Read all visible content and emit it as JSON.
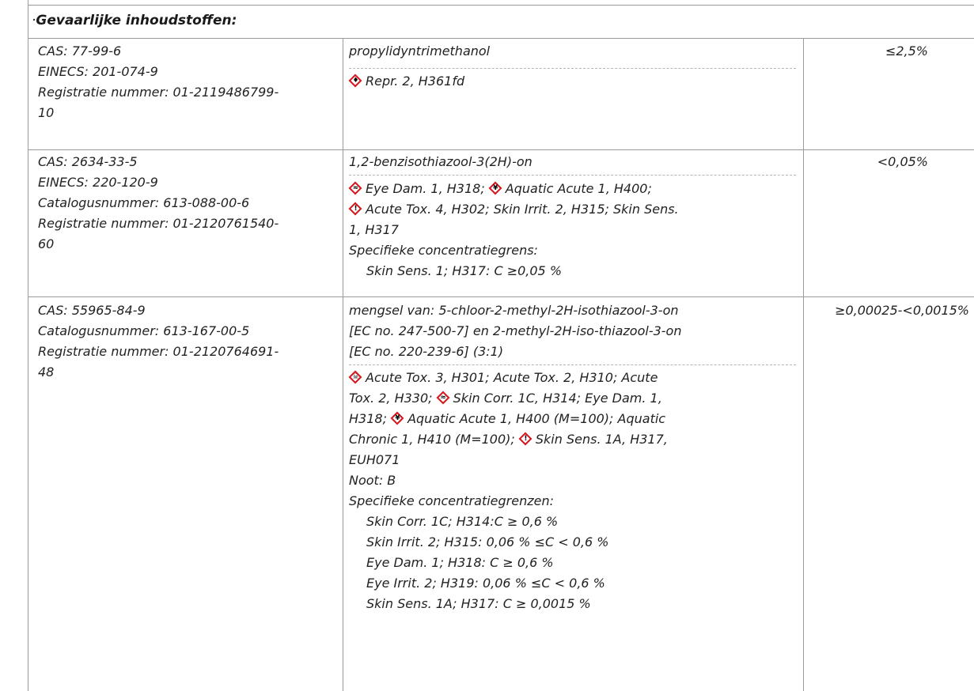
{
  "section": {
    "bullet": "·",
    "title": "Gevaarlijke inhoudstoffen:"
  },
  "rows": [
    {
      "left": [
        "CAS: 77-99-6",
        "EINECS: 201-074-9",
        "Registratie nummer: 01-2119486799-",
        "10"
      ],
      "name": "propylidyntrimethanol",
      "hazards": [
        "Repr. 2, H361fd"
      ],
      "concentration": "≤2,5%"
    },
    {
      "left": [
        "CAS: 2634-33-5",
        "EINECS: 220-120-9",
        "Catalogusnummer: 613-088-00-6",
        "Registratie nummer: 01-2120761540-",
        "60"
      ],
      "name": "1,2-benzisothiazool-3(2H)-on",
      "hazards": [
        "Eye Dam. 1, H318;",
        "Aquatic Acute 1, H400;",
        "Acute Tox. 4, H302; Skin Irrit. 2, H315; Skin Sens.",
        "1, H317",
        "Specifieke concentratiegrens:",
        "Skin Sens. 1; H317: C ≥0,05 %"
      ],
      "concentration": "<0,05%"
    },
    {
      "left": [
        "CAS: 55965-84-9",
        "Catalogusnummer: 613-167-00-5",
        "Registratie nummer: 01-2120764691-",
        "48"
      ],
      "name": [
        "mengsel van: 5-chloor-2-methyl-2H-isothiazool-3-on",
        "[EC no. 247-500-7] en 2-methyl-2H-iso-thiazool-3-on",
        "[EC no. 220-239-6] (3:1)"
      ],
      "hazards": [
        "Acute Tox. 3, H301; Acute Tox. 2, H310; Acute",
        "Tox. 2, H330;",
        "Skin Corr. 1C, H314; Eye Dam. 1,",
        "H318;",
        "Aquatic Acute 1, H400 (M=100); Aquatic",
        "Chronic 1, H410 (M=100);",
        "Skin Sens. 1A, H317,",
        "EUH071",
        "Noot: B",
        "Specifieke concentratiegrenzen:",
        "Skin Corr. 1C; H314:C ≥ 0,6 %",
        "Skin Irrit. 2; H315: 0,06 % ≤C < 0,6 %",
        "Eye Dam. 1; H318: C ≥ 0,6 %",
        "Eye Irrit. 2; H319: 0,06 % ≤C < 0,6 %",
        "Skin Sens. 1A; H317: C ≥ 0,0015 %"
      ],
      "concentration": "≥0,00025-<0,0015%"
    }
  ],
  "icons": [
    "health-hazard-icon",
    "corrosion-icon",
    "environment-icon",
    "exclamation-icon",
    "skull-crossbones-icon"
  ],
  "colors": {
    "pictogram_border": "#d9141b",
    "rule": "#9a9a9a"
  }
}
